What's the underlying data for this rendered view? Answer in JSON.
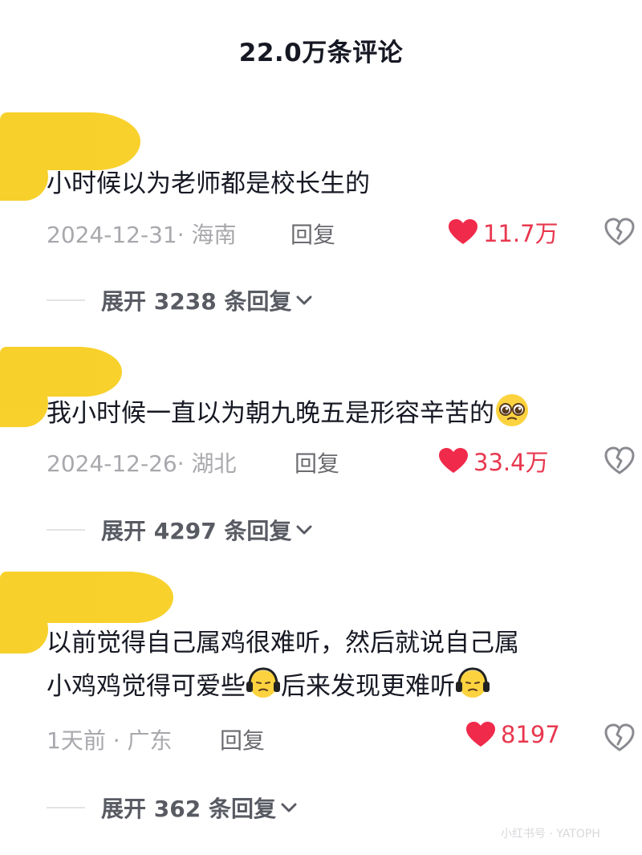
{
  "header": {
    "title": "22.0万条评论"
  },
  "comments": [
    {
      "text": "小时候以为老师都是校长生的",
      "meta": "2024-12-31· 海南",
      "reply_label": "回复",
      "likes": "11.7万",
      "expand_label": "展开 3238 条回复"
    },
    {
      "text": "我小时候一直以为朝九晚五是形容辛苦的",
      "meta": "2024-12-26· 湖北",
      "reply_label": "回复",
      "likes": "33.4万",
      "expand_label": "展开 4297 条回复"
    },
    {
      "text_line1": "以前觉得自己属鸡很难听，然后就说自己属",
      "text_line2_a": "小鸡鸡觉得可爱些",
      "text_line2_b": "后来发现更难听",
      "meta": "1天前 · 广东",
      "reply_label": "回复",
      "likes": "8197",
      "expand_label": "展开 362 条回复"
    }
  ],
  "watermark": "小红书号 · YATOPH",
  "icons": {
    "like": "heart-icon",
    "dislike": "broken-heart-icon",
    "expand": "chevron-down-icon",
    "emoji_pleading": "pleading-face-emoji",
    "emoji_headphones": "headphones-face-emoji"
  },
  "colors": {
    "like": "#e8384f",
    "meta": "#a8a8ad",
    "smudge": "#f7cd1a"
  }
}
